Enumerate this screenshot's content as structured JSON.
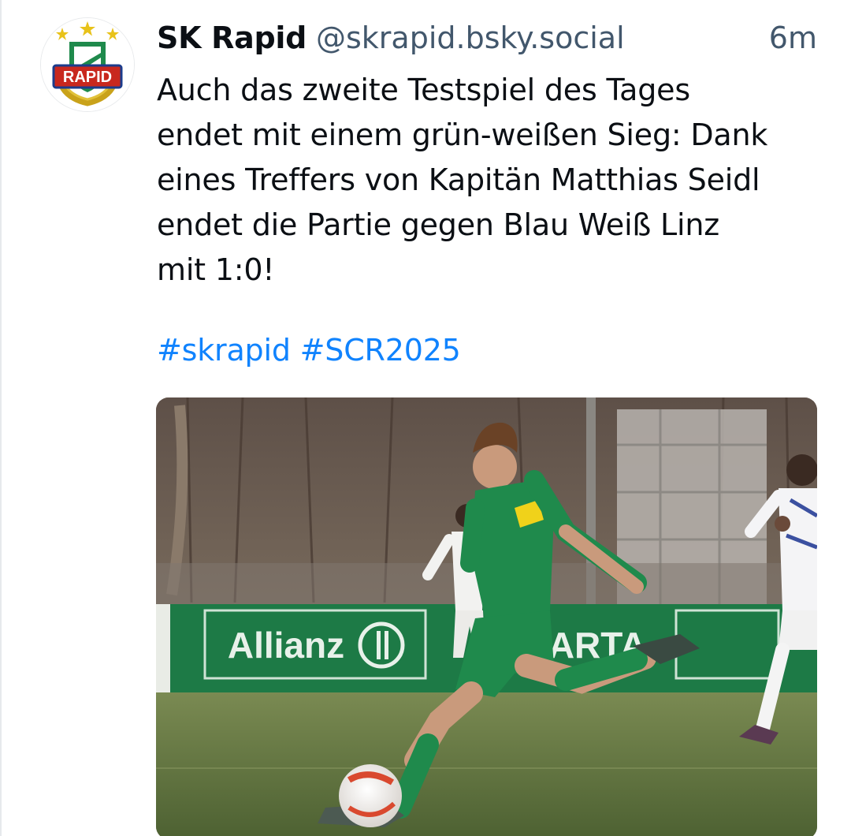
{
  "post": {
    "author": {
      "display_name": "SK Rapid",
      "handle": "@skrapid.bsky.social",
      "avatar_icon": "sk-rapid-crest-icon",
      "avatar_text": "RAPID"
    },
    "timestamp": "6m",
    "text": "Auch das zweite Testspiel des Tages\nendet mit einem grün-weißen Sieg: Dank\neines Treffers von Kapitän Matthias Seidl\nendet die Partie gegen Blau Weiß Linz\nmit 1:0!",
    "hashtags": [
      "#skrapid",
      "#SCR2025"
    ],
    "image": {
      "boards": [
        "Allianz",
        "ARTA"
      ]
    }
  },
  "colors": {
    "link": "#1083fe",
    "rapid_green": "#1f8a4c",
    "handle_gray": "#42576c"
  }
}
